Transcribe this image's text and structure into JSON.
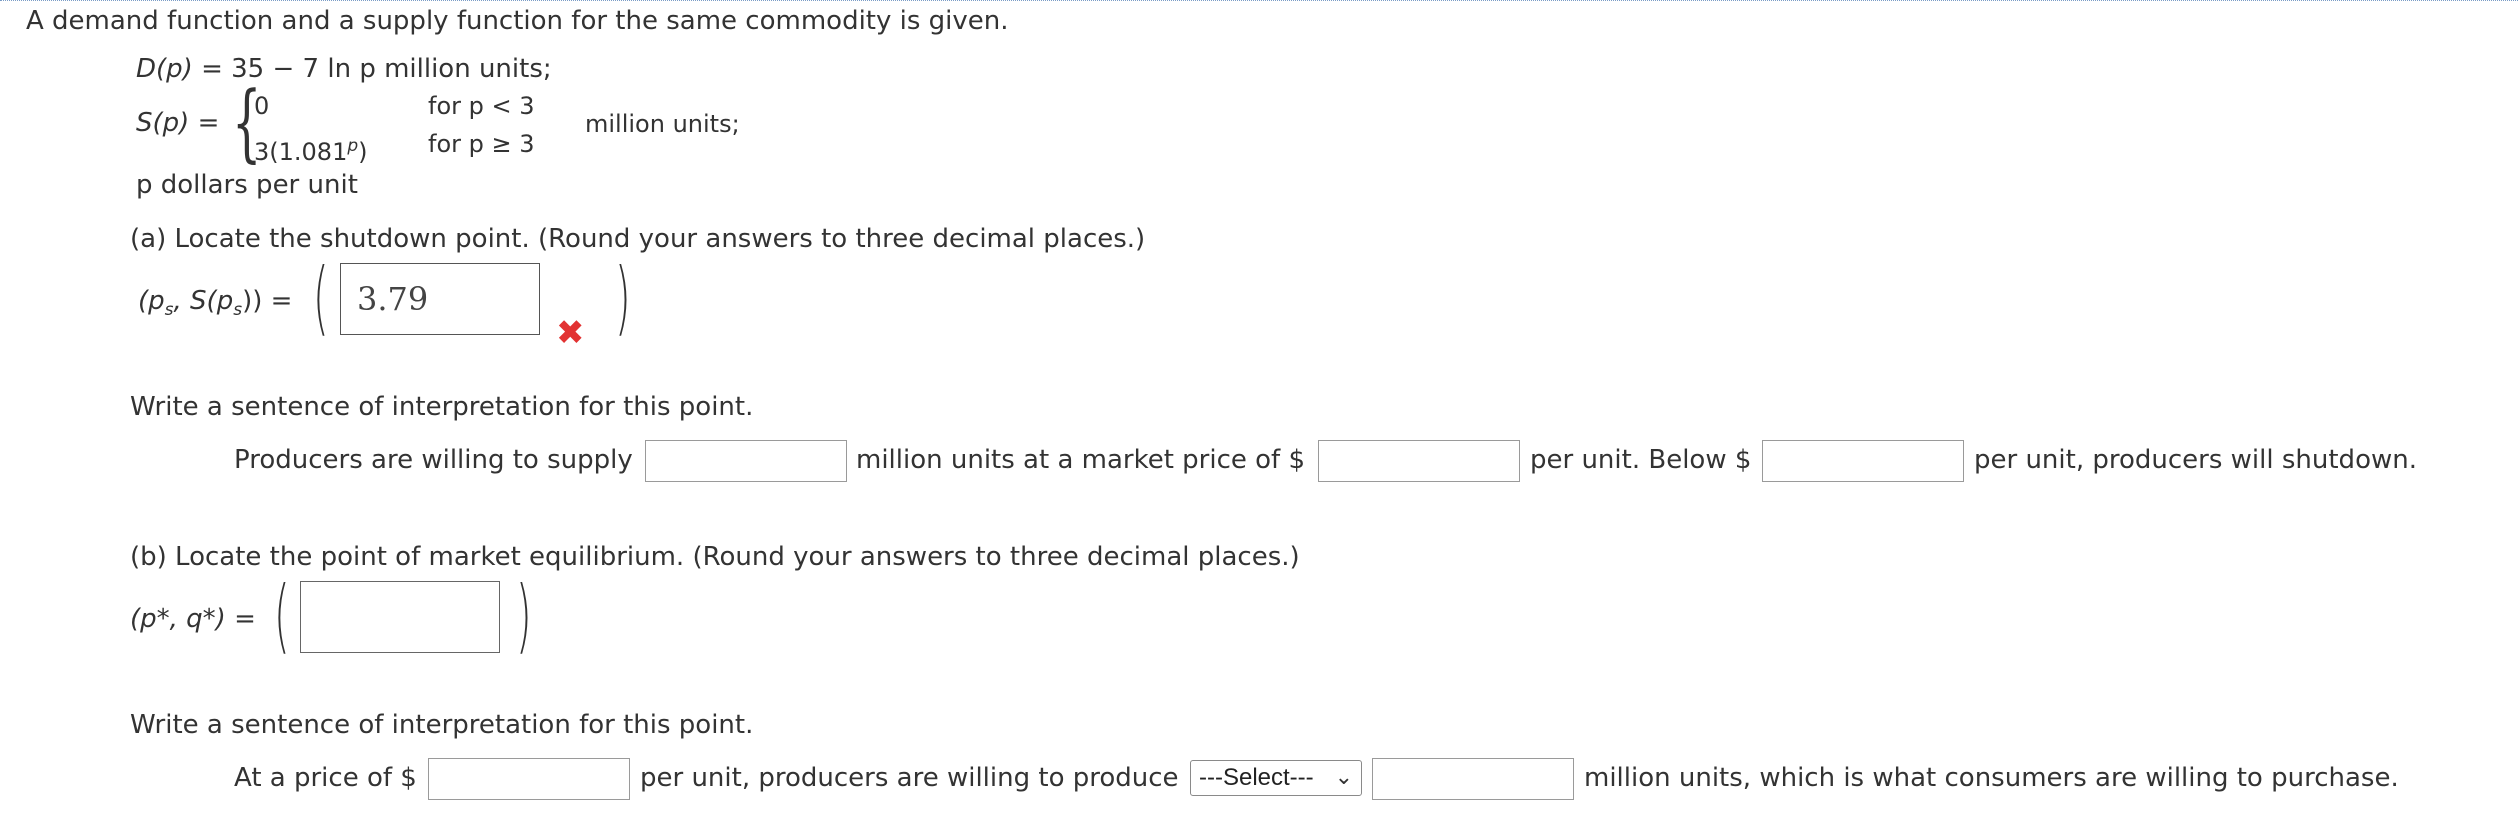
{
  "problem": {
    "intro": "A demand function and a supply function for the same commodity is given.",
    "demand": {
      "lhs": "D(p)",
      "eq": "=",
      "rhs": "35 − 7 ln p million units;"
    },
    "supply": {
      "lhs": "S(p)",
      "eq": "=",
      "case1_value": "0",
      "case1_cond": "for p < 3",
      "case2_value": "3(1.081",
      "case2_exp": "p",
      "case2_close": ")",
      "case2_cond": "for p ≥ 3",
      "units": "million units;"
    },
    "price_units": "p dollars per unit"
  },
  "part_a": {
    "prompt": "(a) Locate the shutdown point. (Round your answers to three decimal places.)",
    "point_label": "(p",
    "point_sub": "s",
    "point_mid": ", S(p",
    "point_sub2": "s",
    "point_end": ")) =",
    "answer_value": "3.79",
    "answer_status": "incorrect",
    "interp_heading": "Write a sentence of interpretation for this point.",
    "sentence": {
      "s1": "Producers are willing to supply",
      "s2": "million units at a market price of $",
      "s3": "per unit. Below $",
      "s4": "per unit, producers will shutdown."
    }
  },
  "part_b": {
    "prompt": "(b) Locate the point of market equilibrium. (Round your answers to three decimal places.)",
    "point_label": "(p*, q*) =",
    "answer_value": "",
    "interp_heading": "Write a sentence of interpretation for this point.",
    "sentence": {
      "s1": "At a price of $",
      "s2": "per unit, producers are willing to produce",
      "select_value": "---Select---",
      "s3": "million units, which is what consumers are willing to purchase."
    }
  },
  "icons": {
    "incorrect": "x-mark-icon",
    "dropdown": "chevron-down-icon"
  },
  "colors": {
    "incorrect": "#e23232",
    "text": "#333333"
  }
}
